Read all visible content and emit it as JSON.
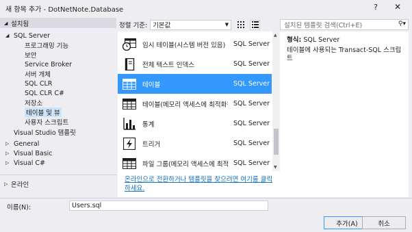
{
  "window": {
    "title": "새 항목 추가 - DotNetNote.Database",
    "help": "?",
    "close": "✕"
  },
  "tree": {
    "header": "설치됨",
    "items": [
      {
        "label": "SQL Server",
        "arrow": "◢",
        "indent": 0
      },
      {
        "label": "프로그래밍 기능",
        "indent": 1
      },
      {
        "label": "보안",
        "indent": 1
      },
      {
        "label": "Service Broker",
        "indent": 1
      },
      {
        "label": "서버 개체",
        "indent": 1
      },
      {
        "label": "SQL CLR",
        "indent": 1
      },
      {
        "label": "SQL CLR C#",
        "indent": 1
      },
      {
        "label": "저장소",
        "indent": 1
      },
      {
        "label": "테이블 및 뷰",
        "indent": 1,
        "selected": true
      },
      {
        "label": "사용자 스크립트",
        "indent": 1
      },
      {
        "label": "Visual Studio 템플릿",
        "indent": 0
      },
      {
        "label": "General",
        "arrow": "▷",
        "indent": 0
      },
      {
        "label": "Visual Basic",
        "arrow": "▷",
        "indent": 0
      },
      {
        "label": "Visual C#",
        "arrow": "▷",
        "indent": 0
      }
    ],
    "online": "온라인"
  },
  "sort": {
    "label": "정렬 기준:",
    "value": "기본값"
  },
  "templates": [
    {
      "name": "임시 테이블(시스템 버전 있음)",
      "type": "SQL Server",
      "icon": "clock-table-icon"
    },
    {
      "name": "전체 텍스트 인덱스",
      "type": "SQL Server",
      "icon": "book-icon"
    },
    {
      "name": "테이블",
      "type": "SQL Server",
      "icon": "table-icon",
      "selected": true
    },
    {
      "name": "테이블(메모리 액세스에 최적화됨)",
      "type": "SQL Server",
      "icon": "table-icon"
    },
    {
      "name": "통계",
      "type": "SQL Server",
      "icon": "bar-chart-icon"
    },
    {
      "name": "트리거",
      "type": "SQL Server",
      "icon": "trigger-icon"
    },
    {
      "name": "파일 그룹(메모리 액세스에 최적화됨)",
      "type": "SQL Server",
      "icon": "table-icon"
    }
  ],
  "online_link": "온라인으로 전환하거나 템플릿을 찾으려면 여기를 클릭하세요.",
  "search": {
    "placeholder": "설치된 템플릿 검색(Ctrl+E)"
  },
  "details": {
    "type_label": "형식:",
    "type_value": "SQL Server",
    "description": "테이블에 사용되는 Transact-SQL 스크립트"
  },
  "name_field": {
    "label": "이름(N):",
    "value": "Users.sql"
  },
  "buttons": {
    "add": "추가(A)",
    "cancel": "취소"
  },
  "colors": {
    "selection": "#3399ff",
    "link": "#0e70c0"
  }
}
